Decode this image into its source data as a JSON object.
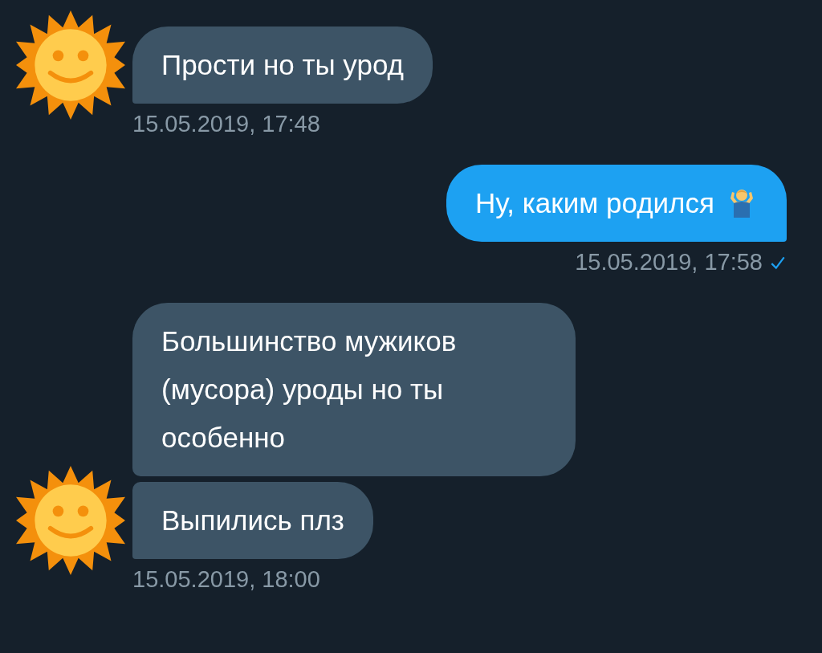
{
  "groups": [
    {
      "kind": "incoming",
      "bubbles": [
        {
          "text": "Прости но ты урод",
          "emoji": false
        }
      ],
      "timestamp": "15.05.2019, 17:48",
      "read": false
    },
    {
      "kind": "outgoing",
      "bubbles": [
        {
          "text": "Ну, каким родился",
          "emoji": true
        }
      ],
      "timestamp": "15.05.2019, 17:58",
      "read": true
    },
    {
      "kind": "incoming",
      "bubbles": [
        {
          "text": "Большинство мужиков (мусора) уроды но ты особенно",
          "emoji": false
        },
        {
          "text": "Выпились плз",
          "emoji": false
        }
      ],
      "timestamp": "15.05.2019, 18:00",
      "read": false
    }
  ]
}
